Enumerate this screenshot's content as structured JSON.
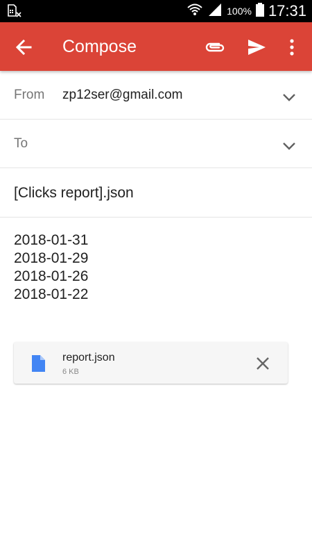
{
  "status_bar": {
    "battery_percent": "100%",
    "time": "17:31",
    "icons": [
      "sim-missing-icon",
      "wifi-icon",
      "signal-icon",
      "battery-icon"
    ]
  },
  "app_bar": {
    "title": "Compose",
    "color": "#db4437",
    "icons": [
      "back-arrow-icon",
      "paperclip-icon",
      "send-icon",
      "more-vert-icon"
    ]
  },
  "compose": {
    "from_label": "From",
    "from_value": "zp12ser@gmail.com",
    "to_label": "To",
    "to_value": "",
    "subject": "[Clicks report].json",
    "body_lines": [
      "2018-01-31",
      "2018-01-29",
      "2018-01-26",
      "2018-01-22"
    ]
  },
  "attachment": {
    "file_name": "report.json",
    "file_size": "6 KB",
    "icon": "file-icon",
    "icon_color": "#4285f4"
  }
}
